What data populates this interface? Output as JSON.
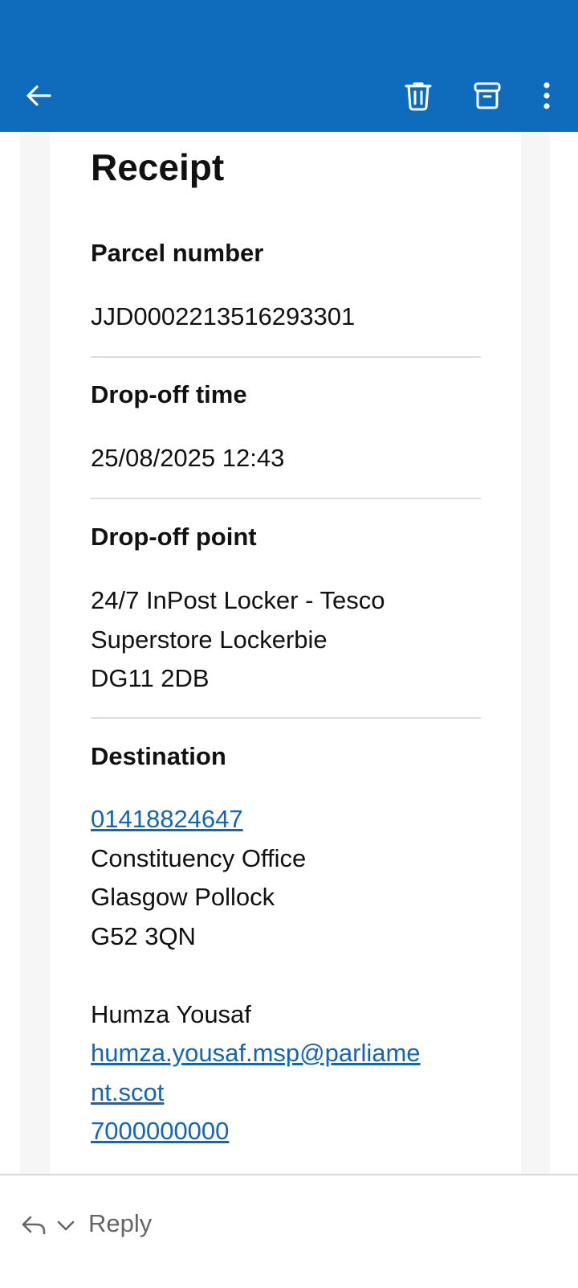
{
  "colors": {
    "appbar": "#0f6cbd",
    "link": "#1565b5",
    "divider": "#dddddd"
  },
  "toolbar": {
    "back_icon": "arrow-left-icon",
    "delete_icon": "trash-icon",
    "archive_icon": "archive-icon",
    "more_icon": "more-vertical-icon"
  },
  "receipt": {
    "title": "Receipt",
    "parcel_number": {
      "label": "Parcel number",
      "value": "JJD0002213516293301"
    },
    "drop_off_time": {
      "label": "Drop-off time",
      "value": "25/08/2025 12:43"
    },
    "drop_off_point": {
      "label": "Drop-off point",
      "lines": [
        "24/7 InPost Locker - Tesco",
        "Superstore Lockerbie",
        "DG11 2DB"
      ]
    },
    "destination": {
      "label": "Destination",
      "phone": "01418824647",
      "address_lines": [
        "Constituency Office",
        "Glasgow Pollock",
        "G52 3QN"
      ],
      "name": "Humza Yousaf",
      "email_line1": "humza.yousaf.msp@parliame",
      "email_line2": "nt.scot",
      "phone2": "7000000000"
    }
  },
  "bottom_bar": {
    "reply_label": "Reply"
  }
}
